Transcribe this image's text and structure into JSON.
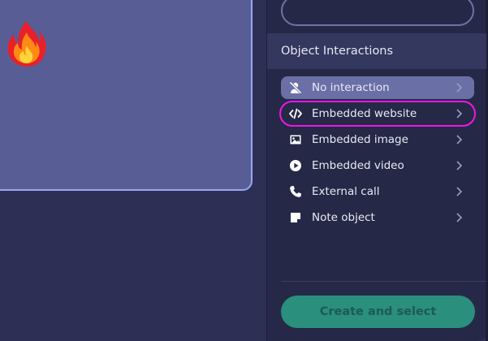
{
  "canvas": {
    "emoji_icon": "fire-icon"
  },
  "panel": {
    "search_value": "",
    "section_title": "Object Interactions",
    "items": [
      {
        "label": "No interaction",
        "icon": "user-slash-icon",
        "state": "selected"
      },
      {
        "label": "Embedded website",
        "icon": "code-icon",
        "state": "highlighted"
      },
      {
        "label": "Embedded image",
        "icon": "image-icon",
        "state": "normal"
      },
      {
        "label": "Embedded video",
        "icon": "play-circle-icon",
        "state": "normal"
      },
      {
        "label": "External call",
        "icon": "phone-icon",
        "state": "normal"
      },
      {
        "label": "Note object",
        "icon": "note-icon",
        "state": "normal"
      }
    ],
    "create_button_label": "Create and select"
  },
  "colors": {
    "background": "#2e2f55",
    "panel": "#262847",
    "card": "#585d96",
    "selected_item": "#6a6fa6",
    "highlight_outline": "#f215e6",
    "primary_button": "#2a8f7d"
  }
}
